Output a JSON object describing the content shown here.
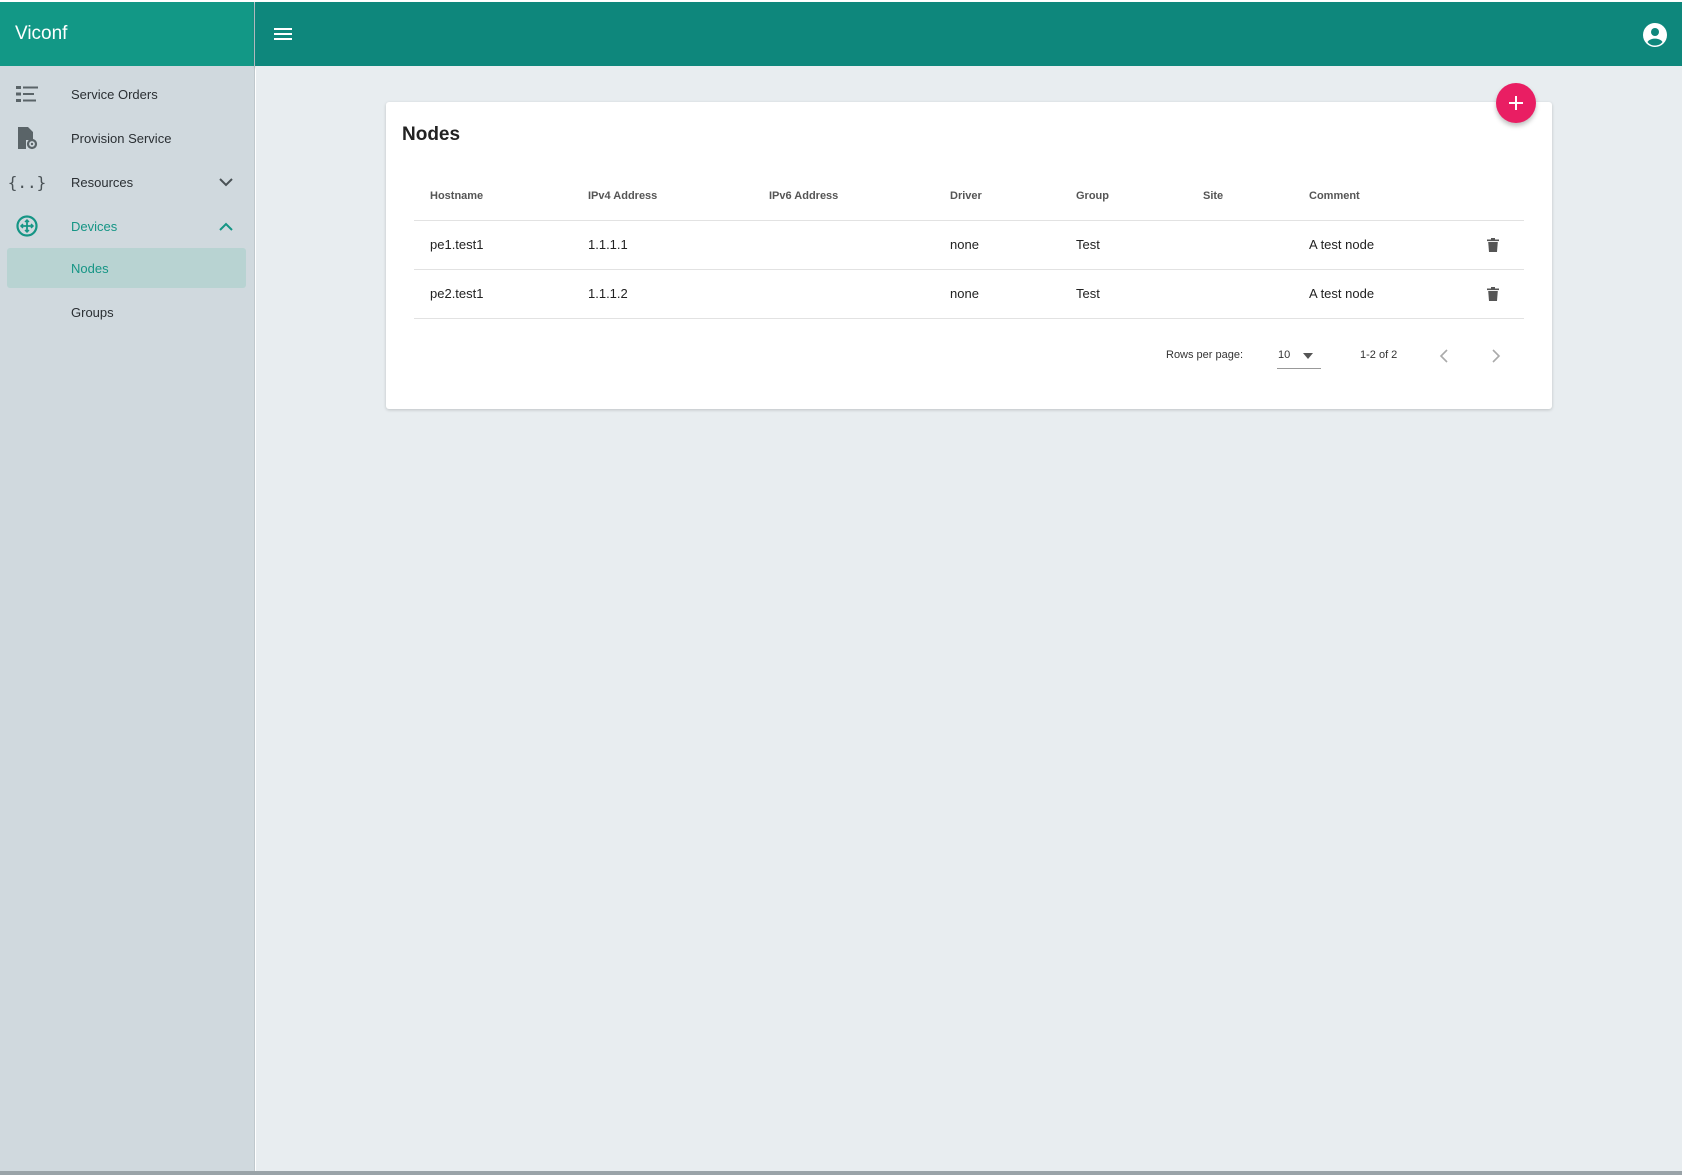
{
  "app": {
    "title": "Viconf"
  },
  "sidebar": {
    "items": [
      {
        "label": "Service Orders",
        "icon": "list-icon"
      },
      {
        "label": "Provision Service",
        "icon": "file-gear-icon"
      },
      {
        "label": "Resources",
        "icon": "braces-icon"
      },
      {
        "label": "Devices",
        "icon": "router-icon"
      }
    ],
    "devices_children": [
      {
        "label": "Nodes"
      },
      {
        "label": "Groups"
      }
    ]
  },
  "page": {
    "title": "Nodes"
  },
  "table": {
    "columns": [
      "Hostname",
      "IPv4 Address",
      "IPv6 Address",
      "Driver",
      "Group",
      "Site",
      "Comment"
    ],
    "rows": [
      {
        "hostname": "pe1.test1",
        "ipv4": "1.1.1.1",
        "ipv6": "",
        "driver": "none",
        "group": "Test",
        "site": "",
        "comment": "A test node"
      },
      {
        "hostname": "pe2.test1",
        "ipv4": "1.1.1.2",
        "ipv6": "",
        "driver": "none",
        "group": "Test",
        "site": "",
        "comment": "A test node"
      }
    ]
  },
  "pagination": {
    "rows_per_page_label": "Rows per page:",
    "rows_per_page": "10",
    "range": "1-2 of 2"
  },
  "colors": {
    "topbar": "#0e877c",
    "brand": "#129886",
    "accent": "#159585",
    "fab": "#e91e63"
  }
}
